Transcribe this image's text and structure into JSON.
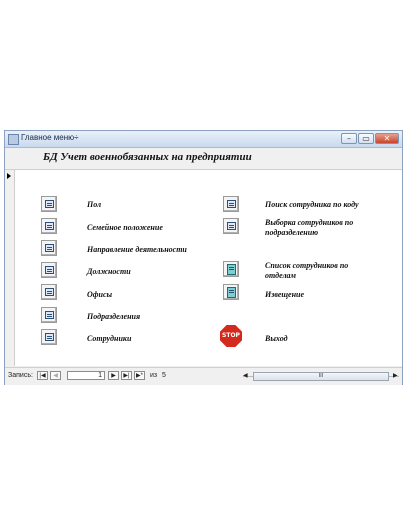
{
  "window": {
    "title": "Главное меню÷",
    "controls": {
      "minimize": "–",
      "maximize": "▭",
      "close": "✕"
    }
  },
  "form": {
    "header": "БД Учет военнобязанных на предприятии",
    "left_items": [
      {
        "label": "Пол"
      },
      {
        "label": "Семейное положение"
      },
      {
        "label": "Направление деятельности"
      },
      {
        "label": "Должности"
      },
      {
        "label": "Офисы"
      },
      {
        "label": "Подразделения"
      },
      {
        "label": "Сотрудники"
      }
    ],
    "right_items": [
      {
        "label": "Поиск сотрудника по коду"
      },
      {
        "label": "Выборка сотрудников по подразделению"
      },
      {
        "label": "Список сотрудников по отделам"
      },
      {
        "label": "Извещение"
      },
      {
        "label": "Выход",
        "button_text": "STOP"
      }
    ]
  },
  "statusbar": {
    "record_label": "Запись:",
    "current_record": "1",
    "of_label": "из",
    "total_records": "5",
    "nav": {
      "first": "|◀",
      "prev": "◀",
      "next": "▶",
      "last": "▶|",
      "new": "▶*"
    },
    "scroll_thumb": "III"
  },
  "colors": {
    "window_border": "#8aa2bf",
    "titlebar": "#c9d9ee",
    "close_button": "#c7452a",
    "stop_sign": "#d42a1e",
    "report_icon": "#7ecfcf"
  }
}
